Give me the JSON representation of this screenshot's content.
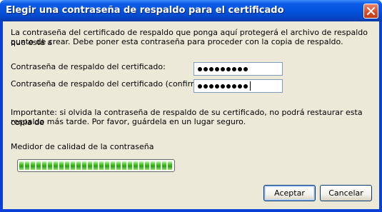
{
  "window": {
    "title": "Elegir una contraseña de respaldo para el certificado"
  },
  "intro": {
    "line1": "La contraseña del certificado de respaldo que ponga aquí protegerá el archivo de respaldo que está a",
    "line2": "punto de crear. Debe poner esta contraseña para proceder con la copia de respaldo."
  },
  "fields": {
    "password_label": "Contraseña de respaldo del certificado:",
    "password_value_length": 9,
    "confirm_label": "Contraseña de respaldo del certificado (confirmar):",
    "confirm_value_length": 9
  },
  "warning": {
    "line1": "Importante: si olvida la contraseña de respaldo de su certificado, no podrá restaurar esta copia de",
    "line2": "respaldo más tarde. Por favor, guárdela en un lugar seguro."
  },
  "meter": {
    "label": "Medidor de calidad de la contraseña",
    "level": 1.0,
    "color": "#2ba50e"
  },
  "buttons": {
    "accept_label": "Aceptar",
    "cancel_label": "Cancelar"
  },
  "colors": {
    "titlebar": "#0552dc",
    "client_bg": "#ece9d8",
    "close_btn": "#d84f2b"
  }
}
